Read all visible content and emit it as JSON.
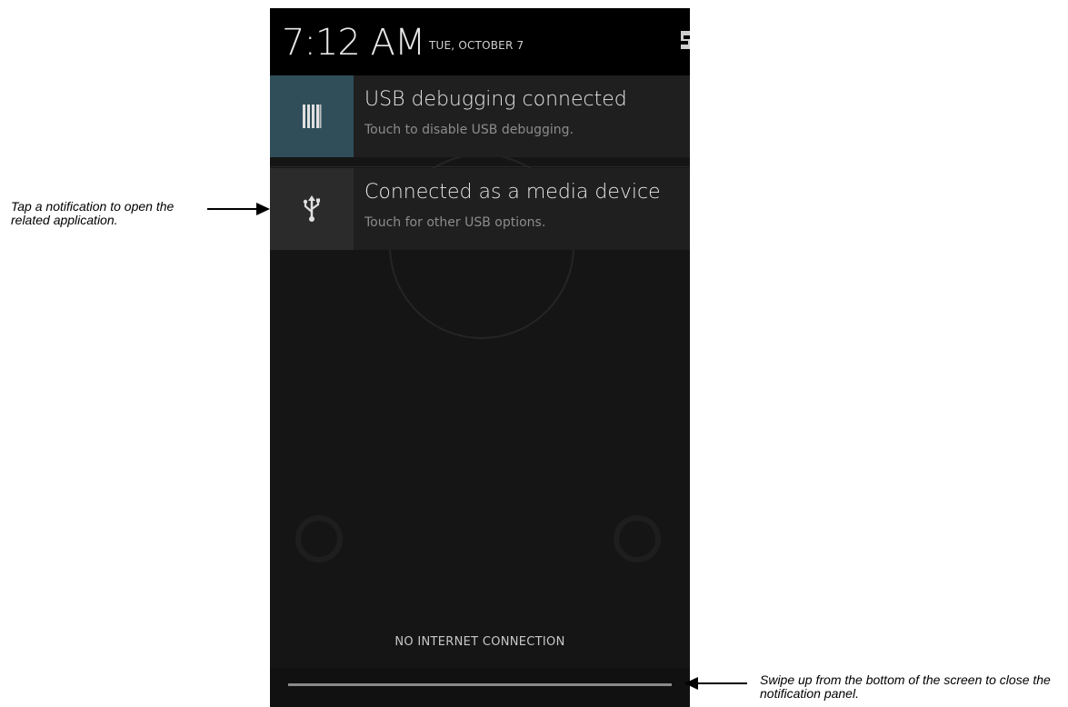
{
  "status": {
    "time": "7:12 AM",
    "date": "TUE, OCTOBER 7"
  },
  "notifications": [
    {
      "title": "USB debugging connected",
      "subtitle": "Touch to disable USB debugging.",
      "icon": "usb-debugging-icon"
    },
    {
      "title": "Connected as a media device",
      "subtitle": "Touch for other USB options.",
      "icon": "usb-icon"
    }
  ],
  "footer": {
    "network_status": "NO INTERNET CONNECTION"
  },
  "annotations": {
    "tap_notification": "Tap a notification to open the related application.",
    "swipe_up": "Swipe up from the bottom of the screen to close the notification panel."
  },
  "colors": {
    "panel_bg": "#151515",
    "header_bg": "#000000",
    "debug_icon_bg": "#2f4e5a",
    "notification_bg": "#1f1f1f"
  }
}
